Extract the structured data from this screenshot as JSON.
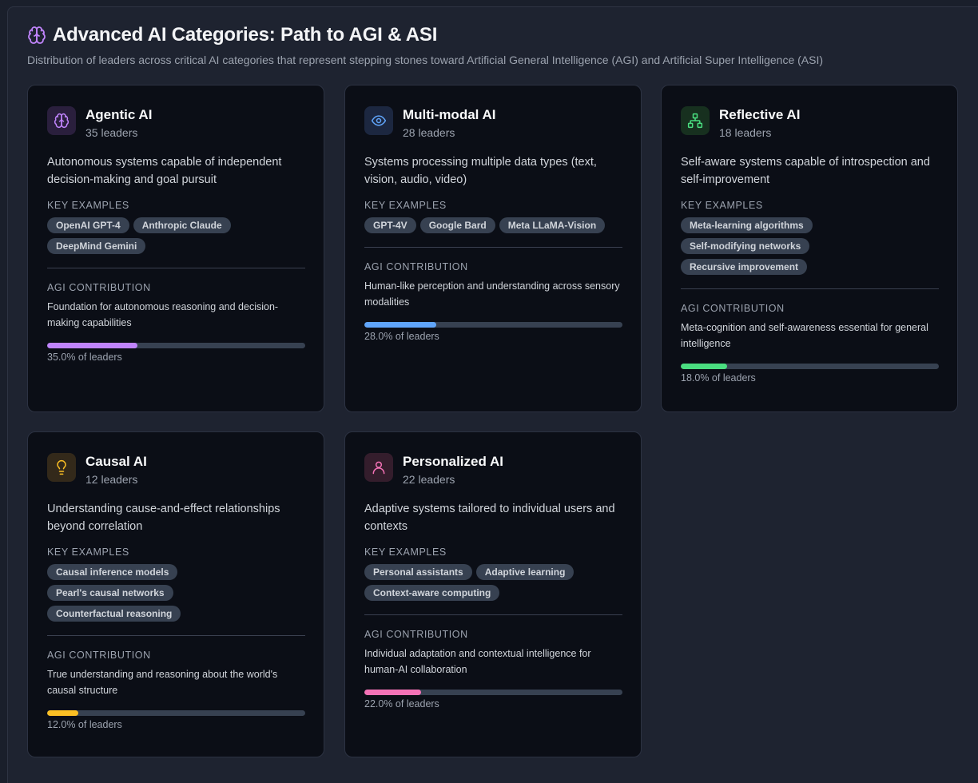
{
  "header": {
    "title": "Advanced AI Categories: Path to AGI & ASI",
    "subtitle": "Distribution of leaders across critical AI categories that represent stepping stones toward Artificial General Intelligence (AGI) and Artificial Super Intelligence (ASI)",
    "icon": "brain-icon"
  },
  "labels": {
    "key_examples": "KEY EXAMPLES",
    "agi_contribution": "AGI CONTRIBUTION"
  },
  "cards": [
    {
      "name": "Agentic AI",
      "count": "35 leaders",
      "description": "Autonomous systems capable of independent decision-making and goal pursuit",
      "examples": [
        "OpenAI GPT-4",
        "Anthropic Claude",
        "DeepMind Gemini"
      ],
      "contribution": "Foundation for autonomous reasoning and decision-making capabilities",
      "percent": 35.0,
      "percent_label": "35.0% of leaders",
      "icon": "brain-icon",
      "color": "#c084fc",
      "icon_bg": "#2a1f3d"
    },
    {
      "name": "Multi-modal AI",
      "count": "28 leaders",
      "description": "Systems processing multiple data types (text, vision, audio, video)",
      "examples": [
        "GPT-4V",
        "Google Bard",
        "Meta LLaMA-Vision"
      ],
      "contribution": "Human-like perception and understanding across sensory modalities",
      "percent": 28.0,
      "percent_label": "28.0% of leaders",
      "icon": "eye-icon",
      "color": "#60a5fa",
      "icon_bg": "#1c2740"
    },
    {
      "name": "Reflective AI",
      "count": "18 leaders",
      "description": "Self-aware systems capable of introspection and self-improvement",
      "examples": [
        "Meta-learning algorithms",
        "Self-modifying networks",
        "Recursive improvement"
      ],
      "contribution": "Meta-cognition and self-awareness essential for general intelligence",
      "percent": 18.0,
      "percent_label": "18.0% of leaders",
      "icon": "network-icon",
      "color": "#4ade80",
      "icon_bg": "#17301f"
    },
    {
      "name": "Causal AI",
      "count": "12 leaders",
      "description": "Understanding cause-and-effect relationships beyond correlation",
      "examples": [
        "Causal inference models",
        "Pearl's causal networks",
        "Counterfactual reasoning"
      ],
      "contribution": "True understanding and reasoning about the world's causal structure",
      "percent": 12.0,
      "percent_label": "12.0% of leaders",
      "icon": "lightbulb-icon",
      "color": "#fbbf24",
      "icon_bg": "#33291a"
    },
    {
      "name": "Personalized AI",
      "count": "22 leaders",
      "description": "Adaptive systems tailored to individual users and contexts",
      "examples": [
        "Personal assistants",
        "Adaptive learning",
        "Context-aware computing"
      ],
      "contribution": "Individual adaptation and contextual intelligence for human-AI collaboration",
      "percent": 22.0,
      "percent_label": "22.0% of leaders",
      "icon": "user-icon",
      "color": "#f472b6",
      "icon_bg": "#341d2c"
    }
  ]
}
